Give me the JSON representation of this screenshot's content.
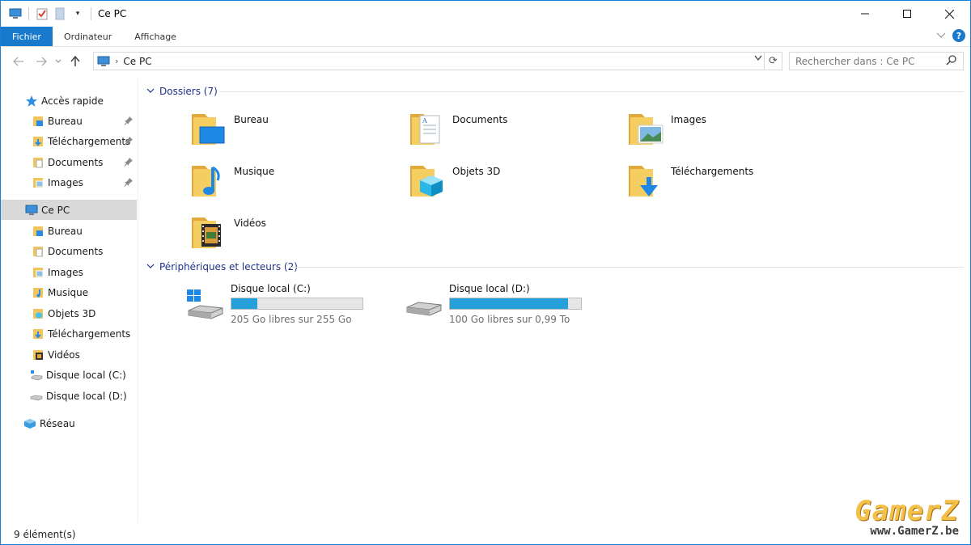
{
  "window": {
    "title": "Ce PC"
  },
  "ribbon": {
    "tabs": [
      "Fichier",
      "Ordinateur",
      "Affichage"
    ]
  },
  "address": {
    "crumbs": [
      "Ce PC"
    ]
  },
  "search": {
    "placeholder": "Rechercher dans : Ce PC"
  },
  "sidebar": {
    "quick_access": "Accès rapide",
    "quick_items": [
      "Bureau",
      "Téléchargements",
      "Documents",
      "Images"
    ],
    "this_pc": "Ce PC",
    "pc_items": [
      "Bureau",
      "Documents",
      "Images",
      "Musique",
      "Objets 3D",
      "Téléchargements",
      "Vidéos",
      "Disque local (C:)",
      "Disque local (D:)"
    ],
    "network": "Réseau"
  },
  "content": {
    "folders_group": "Dossiers (7)",
    "folders": [
      "Bureau",
      "Documents",
      "Images",
      "Musique",
      "Objets 3D",
      "Téléchargements",
      "Vidéos"
    ],
    "devices_group": "Périphériques et lecteurs (2)",
    "drives": [
      {
        "name": "Disque local (C:)",
        "free": "205 Go libres sur 255 Go",
        "used_fraction": 0.196
      },
      {
        "name": "Disque local (D:)",
        "free": "100 Go libres sur 0,99 To",
        "used_fraction": 0.9
      }
    ]
  },
  "status": {
    "count": "9 élément(s)"
  },
  "watermark": {
    "logo": "GamerZ",
    "url": "www.GamerZ.be"
  },
  "colors": {
    "accent": "#1979ca",
    "drive_fill": "#26a0da",
    "group_heading": "#1e3287",
    "folder": "#f2c55c"
  }
}
